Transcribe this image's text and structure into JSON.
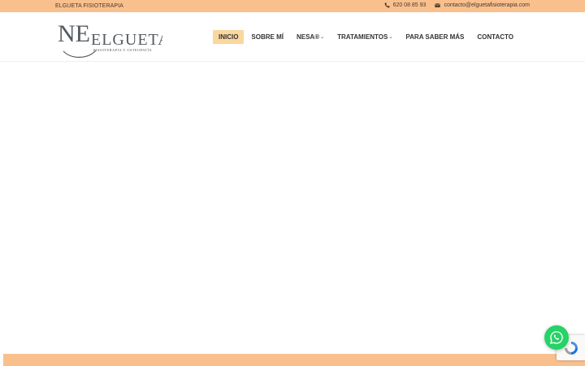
{
  "topbar": {
    "brand": "ELGUETA FISIOTERAPIA",
    "phone": "620 08 85 93",
    "email": "contacto@elguetafisioterapia.com",
    "phone_icon": "phone-icon",
    "email_icon": "envelope-icon"
  },
  "logo": {
    "name": "ELGUETA",
    "tagline": "FISIOTERAPIA Y OSTEOPATÍA",
    "monogram": "NE"
  },
  "nav": {
    "items": [
      {
        "label": "INICIO",
        "active": true
      },
      {
        "label": "SOBRE MÍ"
      },
      {
        "label": "NESA®",
        "dropdown": true
      },
      {
        "label": "TRATAMIENTOS",
        "dropdown": true
      },
      {
        "label": "PARA SABER MÁS"
      },
      {
        "label": "CONTACTO"
      }
    ]
  },
  "widgets": {
    "whatsapp_icon": "whatsapp-icon",
    "recaptcha_icon": "recaptcha-icon"
  },
  "colors": {
    "accent": "#f9c08e",
    "active_nav": "#f9d79e",
    "whatsapp": "#25d366"
  }
}
